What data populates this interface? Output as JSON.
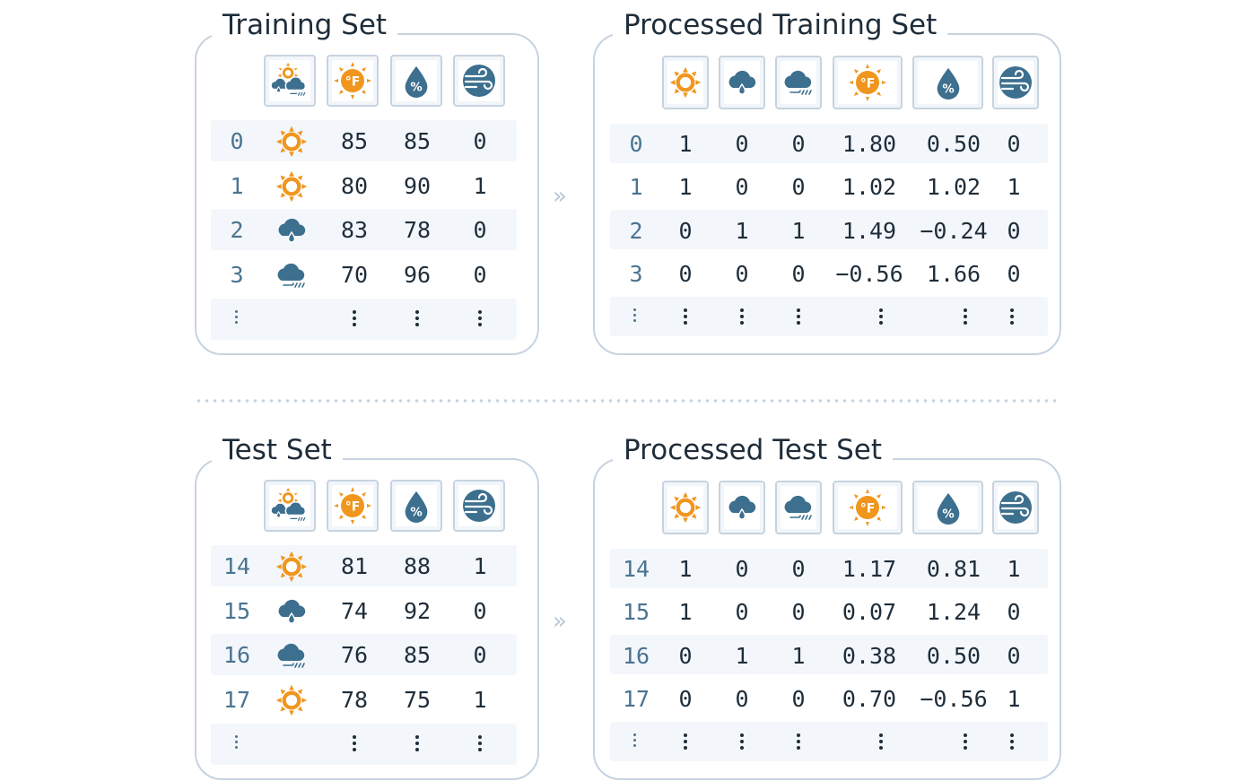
{
  "panels": {
    "train": {
      "title": "Training Set"
    },
    "proc_train": {
      "title": "Processed Training Set"
    },
    "test": {
      "title": "Test Set"
    },
    "proc_test": {
      "title": "Processed Test Set"
    }
  },
  "icons": {
    "raw_headers": [
      "sun-cloud-rain-icon",
      "thermometer-fahrenheit-icon",
      "humidity-drop-icon",
      "wind-icon"
    ],
    "processed_headers": [
      "sun-icon",
      "rain-cloud-icon",
      "windy-cloud-icon",
      "thermometer-fahrenheit-icon",
      "humidity-drop-icon",
      "wind-icon"
    ]
  },
  "colors": {
    "orange": "#f0961e",
    "blue": "#3d6f8e",
    "border": "#c7d3e0",
    "band": "#f3f7fb"
  },
  "train_rows": [
    {
      "idx": "0",
      "weather": "sun",
      "temp": "85",
      "hum": "85",
      "wind": "0"
    },
    {
      "idx": "1",
      "weather": "sun",
      "temp": "80",
      "hum": "90",
      "wind": "1"
    },
    {
      "idx": "2",
      "weather": "rain",
      "temp": "83",
      "hum": "78",
      "wind": "0"
    },
    {
      "idx": "3",
      "weather": "cloud",
      "temp": "70",
      "hum": "96",
      "wind": "0"
    }
  ],
  "proc_train_rows": [
    {
      "idx": "0",
      "c1": "1",
      "c2": "0",
      "c3": "0",
      "temp": "1.80",
      "hum": "0.50",
      "wind": "0"
    },
    {
      "idx": "1",
      "c1": "1",
      "c2": "0",
      "c3": "0",
      "temp": "1.02",
      "hum": "1.02",
      "wind": "1"
    },
    {
      "idx": "2",
      "c1": "0",
      "c2": "1",
      "c3": "1",
      "temp": "1.49",
      "hum": "−0.24",
      "wind": "0"
    },
    {
      "idx": "3",
      "c1": "0",
      "c2": "0",
      "c3": "0",
      "temp": "−0.56",
      "hum": "1.66",
      "wind": "0"
    }
  ],
  "test_rows": [
    {
      "idx": "14",
      "weather": "sun",
      "temp": "81",
      "hum": "88",
      "wind": "1"
    },
    {
      "idx": "15",
      "weather": "rain",
      "temp": "74",
      "hum": "92",
      "wind": "0"
    },
    {
      "idx": "16",
      "weather": "cloud",
      "temp": "76",
      "hum": "85",
      "wind": "0"
    },
    {
      "idx": "17",
      "weather": "sun",
      "temp": "78",
      "hum": "75",
      "wind": "1"
    }
  ],
  "proc_test_rows": [
    {
      "idx": "14",
      "c1": "1",
      "c2": "0",
      "c3": "0",
      "temp": "1.17",
      "hum": "0.81",
      "wind": "1"
    },
    {
      "idx": "15",
      "c1": "1",
      "c2": "0",
      "c3": "0",
      "temp": "0.07",
      "hum": "1.24",
      "wind": "0"
    },
    {
      "idx": "16",
      "c1": "0",
      "c2": "1",
      "c3": "1",
      "temp": "0.38",
      "hum": "0.50",
      "wind": "0"
    },
    {
      "idx": "17",
      "c1": "0",
      "c2": "0",
      "c3": "0",
      "temp": "0.70",
      "hum": "−0.56",
      "wind": "1"
    }
  ],
  "arrow": "»"
}
